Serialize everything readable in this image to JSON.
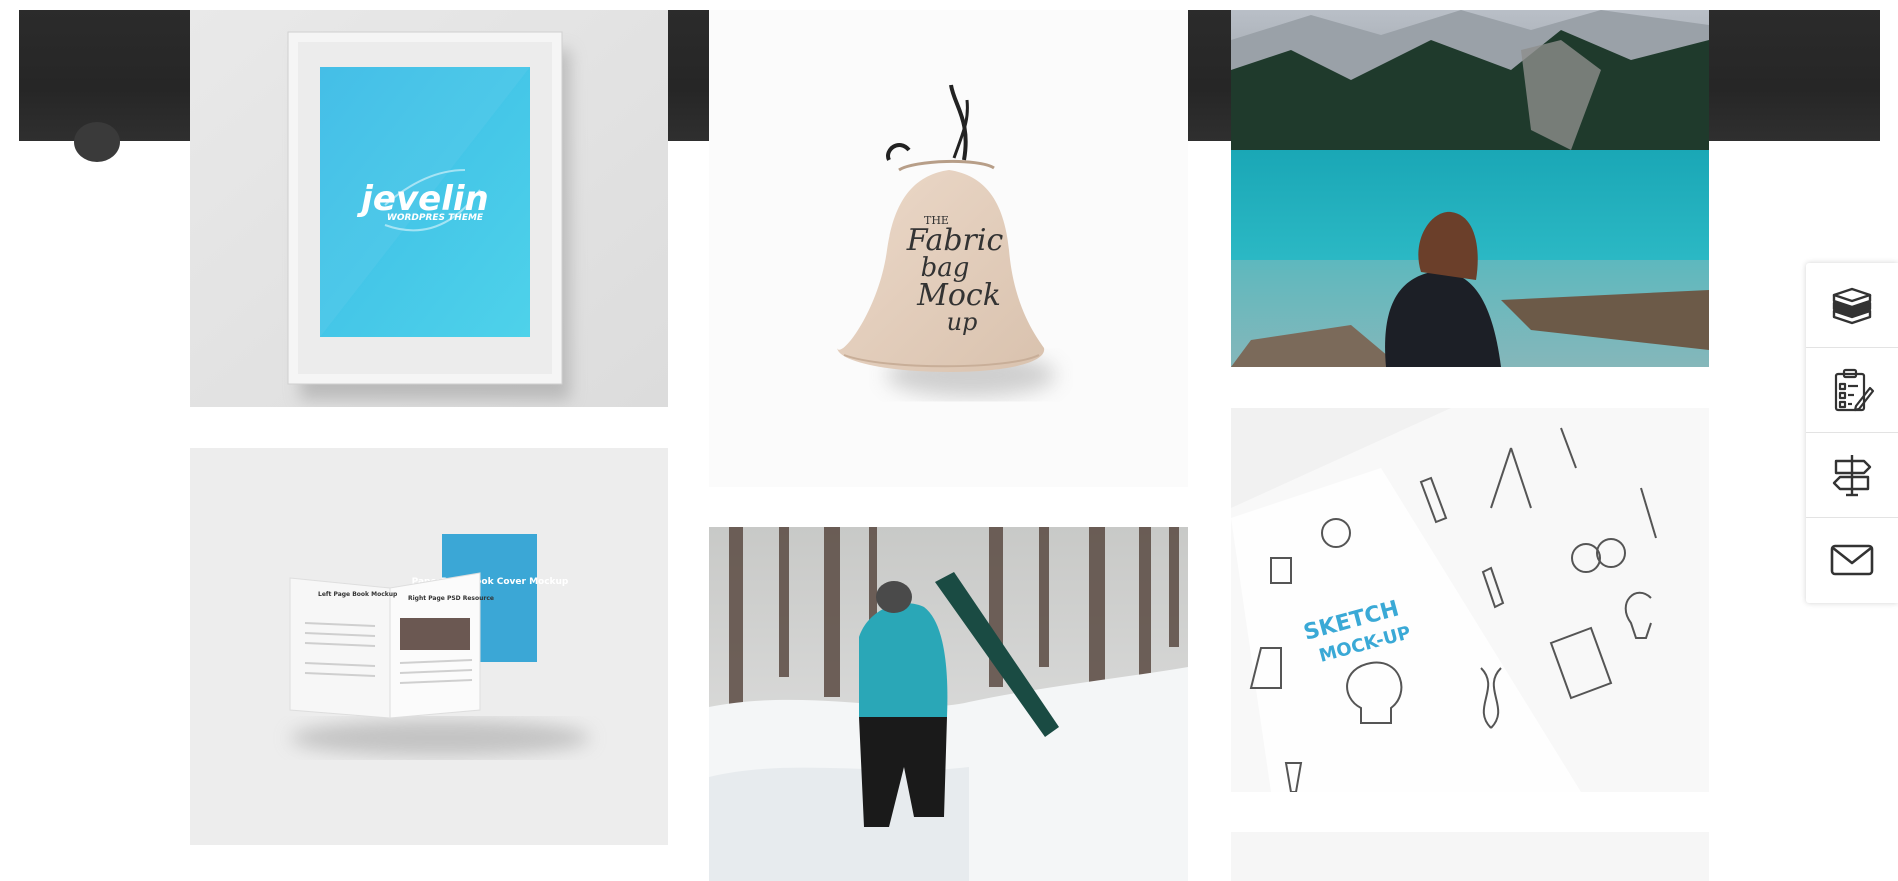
{
  "colors": {
    "hero_band": "#2a2a2a",
    "frame_blue": "#3fc6e8",
    "lake_teal": "#1aa3b0",
    "jacket_teal": "#2aa7b7",
    "sketch_blue": "#3aa9d6"
  },
  "gallery": {
    "items": [
      {
        "id": "frame-mockup",
        "logo_text": "jevelin",
        "logo_subtext": "WORDPRES THEME"
      },
      {
        "id": "fabric-bag",
        "bag_text_small": "THE",
        "bag_text_1": "Fabric",
        "bag_text_2": "bag",
        "bag_text_3": "Mock",
        "bag_text_4": "up"
      },
      {
        "id": "lake-photo"
      },
      {
        "id": "book-mockup",
        "page_left_title": "Left Page Book Mockup",
        "page_right_title": "Right Page PSD Resource",
        "cover_text": "PaperBack Book Cover Mockup"
      },
      {
        "id": "snow-photo"
      },
      {
        "id": "sketch-mockup",
        "title_1": "SKETCH",
        "title_2": "MOCK-UP"
      },
      {
        "id": "partial-tile"
      }
    ]
  },
  "dock": {
    "items": [
      {
        "icon": "books-icon",
        "label": "Docs"
      },
      {
        "icon": "checklist-icon",
        "label": "Changelog"
      },
      {
        "icon": "signpost-icon",
        "label": "Guide"
      },
      {
        "icon": "mail-icon",
        "label": "Contact"
      }
    ]
  }
}
